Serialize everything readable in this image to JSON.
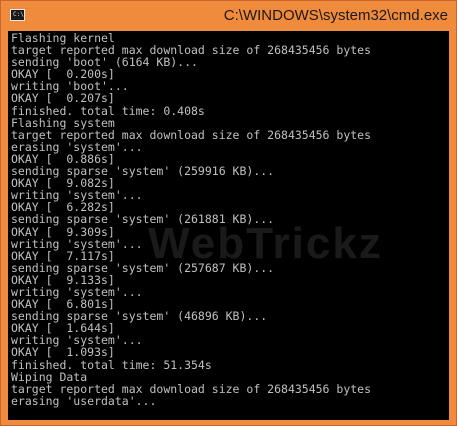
{
  "window": {
    "title": "C:\\WINDOWS\\system32\\cmd.exe",
    "icon": "cmd-icon",
    "frame_color": "#f08a3c"
  },
  "console": {
    "background": "#000000",
    "text_color": "#c0c0c0",
    "lines": [
      "Flashing kernel",
      "target reported max download size of 268435456 bytes",
      "sending 'boot' (6164 KB)...",
      "OKAY [  0.200s]",
      "writing 'boot'...",
      "OKAY [  0.207s]",
      "finished. total time: 0.408s",
      "Flashing system",
      "target reported max download size of 268435456 bytes",
      "erasing 'system'...",
      "OKAY [  0.886s]",
      "sending sparse 'system' (259916 KB)...",
      "OKAY [  9.082s]",
      "writing 'system'...",
      "OKAY [  6.282s]",
      "sending sparse 'system' (261881 KB)...",
      "OKAY [  9.309s]",
      "writing 'system'...",
      "OKAY [  7.117s]",
      "sending sparse 'system' (257687 KB)...",
      "OKAY [  9.133s]",
      "writing 'system'...",
      "OKAY [  6.801s]",
      "sending sparse 'system' (46896 KB)...",
      "OKAY [  1.644s]",
      "writing 'system'...",
      "OKAY [  1.093s]",
      "finished. total time: 51.354s",
      "Wiping Data",
      "target reported max download size of 268435456 bytes",
      "erasing 'userdata'..."
    ]
  },
  "watermark": "WebTrickz"
}
